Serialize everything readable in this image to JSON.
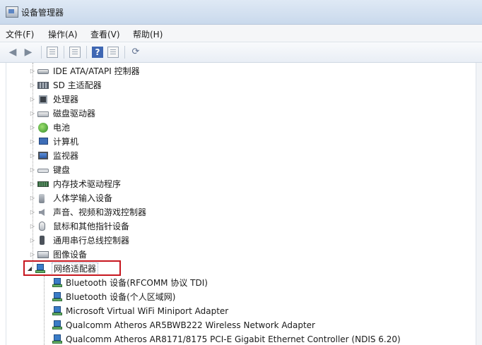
{
  "window": {
    "title": "设备管理器"
  },
  "menu": [
    {
      "label": "文件(F)"
    },
    {
      "label": "操作(A)"
    },
    {
      "label": "查看(V)"
    },
    {
      "label": "帮助(H)"
    }
  ],
  "toolbar": {
    "back_icon": "back-arrow-icon",
    "forward_icon": "forward-arrow-icon",
    "help_glyph": "?",
    "scan_glyph": "⟳"
  },
  "tree": {
    "categories": [
      {
        "label": "IDE ATA/ATAPI 控制器",
        "icon": "ide-controller-icon"
      },
      {
        "label": "SD 主适配器",
        "icon": "sd-host-icon"
      },
      {
        "label": "处理器",
        "icon": "processor-icon"
      },
      {
        "label": "磁盘驱动器",
        "icon": "disk-drive-icon"
      },
      {
        "label": "电池",
        "icon": "battery-icon"
      },
      {
        "label": "计算机",
        "icon": "computer-icon"
      },
      {
        "label": "监视器",
        "icon": "monitor-icon"
      },
      {
        "label": "键盘",
        "icon": "keyboard-icon"
      },
      {
        "label": "内存技术驱动程序",
        "icon": "memory-technology-icon"
      },
      {
        "label": "人体学输入设备",
        "icon": "hid-icon"
      },
      {
        "label": "声音、视频和游戏控制器",
        "icon": "audio-icon"
      },
      {
        "label": "鼠标和其他指针设备",
        "icon": "mouse-icon"
      },
      {
        "label": "通用串行总线控制器",
        "icon": "usb-icon"
      },
      {
        "label": "图像设备",
        "icon": "imaging-icon"
      },
      {
        "label": "网络适配器",
        "icon": "network-adapter-icon",
        "expanded": true,
        "selected": true
      }
    ],
    "network_adapters": [
      {
        "label": "Bluetooth 设备(RFCOMM 协议 TDI)"
      },
      {
        "label": "Bluetooth 设备(个人区域网)"
      },
      {
        "label": "Microsoft Virtual WiFi Miniport Adapter"
      },
      {
        "label": "Qualcomm Atheros AR5BWB222 Wireless Network Adapter"
      },
      {
        "label": "Qualcomm Atheros AR8171/8175 PCI-E Gigabit Ethernet Controller (NDIS 6.20)"
      }
    ]
  },
  "colors": {
    "highlight": "#c7161e",
    "accent": "#3f67b3"
  }
}
